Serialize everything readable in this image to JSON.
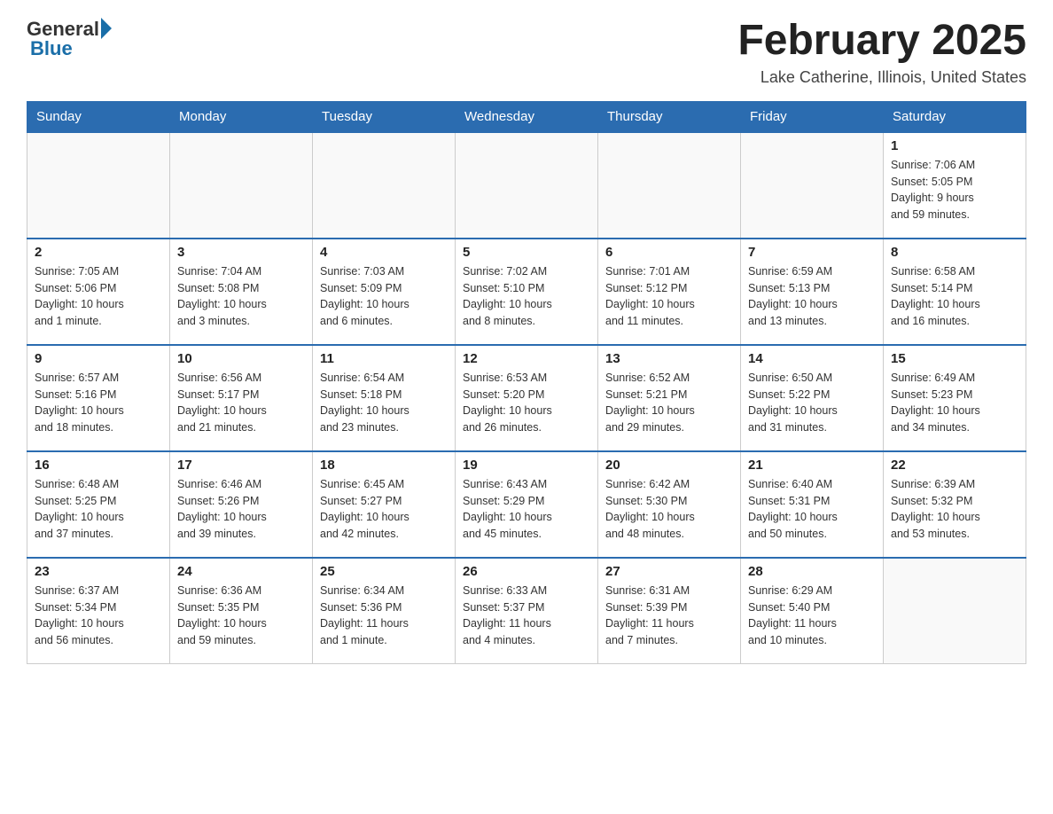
{
  "header": {
    "logo_general": "General",
    "logo_blue": "Blue",
    "title": "February 2025",
    "subtitle": "Lake Catherine, Illinois, United States"
  },
  "weekdays": [
    "Sunday",
    "Monday",
    "Tuesday",
    "Wednesday",
    "Thursday",
    "Friday",
    "Saturday"
  ],
  "weeks": [
    [
      {
        "day": "",
        "info": ""
      },
      {
        "day": "",
        "info": ""
      },
      {
        "day": "",
        "info": ""
      },
      {
        "day": "",
        "info": ""
      },
      {
        "day": "",
        "info": ""
      },
      {
        "day": "",
        "info": ""
      },
      {
        "day": "1",
        "info": "Sunrise: 7:06 AM\nSunset: 5:05 PM\nDaylight: 9 hours\nand 59 minutes."
      }
    ],
    [
      {
        "day": "2",
        "info": "Sunrise: 7:05 AM\nSunset: 5:06 PM\nDaylight: 10 hours\nand 1 minute."
      },
      {
        "day": "3",
        "info": "Sunrise: 7:04 AM\nSunset: 5:08 PM\nDaylight: 10 hours\nand 3 minutes."
      },
      {
        "day": "4",
        "info": "Sunrise: 7:03 AM\nSunset: 5:09 PM\nDaylight: 10 hours\nand 6 minutes."
      },
      {
        "day": "5",
        "info": "Sunrise: 7:02 AM\nSunset: 5:10 PM\nDaylight: 10 hours\nand 8 minutes."
      },
      {
        "day": "6",
        "info": "Sunrise: 7:01 AM\nSunset: 5:12 PM\nDaylight: 10 hours\nand 11 minutes."
      },
      {
        "day": "7",
        "info": "Sunrise: 6:59 AM\nSunset: 5:13 PM\nDaylight: 10 hours\nand 13 minutes."
      },
      {
        "day": "8",
        "info": "Sunrise: 6:58 AM\nSunset: 5:14 PM\nDaylight: 10 hours\nand 16 minutes."
      }
    ],
    [
      {
        "day": "9",
        "info": "Sunrise: 6:57 AM\nSunset: 5:16 PM\nDaylight: 10 hours\nand 18 minutes."
      },
      {
        "day": "10",
        "info": "Sunrise: 6:56 AM\nSunset: 5:17 PM\nDaylight: 10 hours\nand 21 minutes."
      },
      {
        "day": "11",
        "info": "Sunrise: 6:54 AM\nSunset: 5:18 PM\nDaylight: 10 hours\nand 23 minutes."
      },
      {
        "day": "12",
        "info": "Sunrise: 6:53 AM\nSunset: 5:20 PM\nDaylight: 10 hours\nand 26 minutes."
      },
      {
        "day": "13",
        "info": "Sunrise: 6:52 AM\nSunset: 5:21 PM\nDaylight: 10 hours\nand 29 minutes."
      },
      {
        "day": "14",
        "info": "Sunrise: 6:50 AM\nSunset: 5:22 PM\nDaylight: 10 hours\nand 31 minutes."
      },
      {
        "day": "15",
        "info": "Sunrise: 6:49 AM\nSunset: 5:23 PM\nDaylight: 10 hours\nand 34 minutes."
      }
    ],
    [
      {
        "day": "16",
        "info": "Sunrise: 6:48 AM\nSunset: 5:25 PM\nDaylight: 10 hours\nand 37 minutes."
      },
      {
        "day": "17",
        "info": "Sunrise: 6:46 AM\nSunset: 5:26 PM\nDaylight: 10 hours\nand 39 minutes."
      },
      {
        "day": "18",
        "info": "Sunrise: 6:45 AM\nSunset: 5:27 PM\nDaylight: 10 hours\nand 42 minutes."
      },
      {
        "day": "19",
        "info": "Sunrise: 6:43 AM\nSunset: 5:29 PM\nDaylight: 10 hours\nand 45 minutes."
      },
      {
        "day": "20",
        "info": "Sunrise: 6:42 AM\nSunset: 5:30 PM\nDaylight: 10 hours\nand 48 minutes."
      },
      {
        "day": "21",
        "info": "Sunrise: 6:40 AM\nSunset: 5:31 PM\nDaylight: 10 hours\nand 50 minutes."
      },
      {
        "day": "22",
        "info": "Sunrise: 6:39 AM\nSunset: 5:32 PM\nDaylight: 10 hours\nand 53 minutes."
      }
    ],
    [
      {
        "day": "23",
        "info": "Sunrise: 6:37 AM\nSunset: 5:34 PM\nDaylight: 10 hours\nand 56 minutes."
      },
      {
        "day": "24",
        "info": "Sunrise: 6:36 AM\nSunset: 5:35 PM\nDaylight: 10 hours\nand 59 minutes."
      },
      {
        "day": "25",
        "info": "Sunrise: 6:34 AM\nSunset: 5:36 PM\nDaylight: 11 hours\nand 1 minute."
      },
      {
        "day": "26",
        "info": "Sunrise: 6:33 AM\nSunset: 5:37 PM\nDaylight: 11 hours\nand 4 minutes."
      },
      {
        "day": "27",
        "info": "Sunrise: 6:31 AM\nSunset: 5:39 PM\nDaylight: 11 hours\nand 7 minutes."
      },
      {
        "day": "28",
        "info": "Sunrise: 6:29 AM\nSunset: 5:40 PM\nDaylight: 11 hours\nand 10 minutes."
      },
      {
        "day": "",
        "info": ""
      }
    ]
  ]
}
